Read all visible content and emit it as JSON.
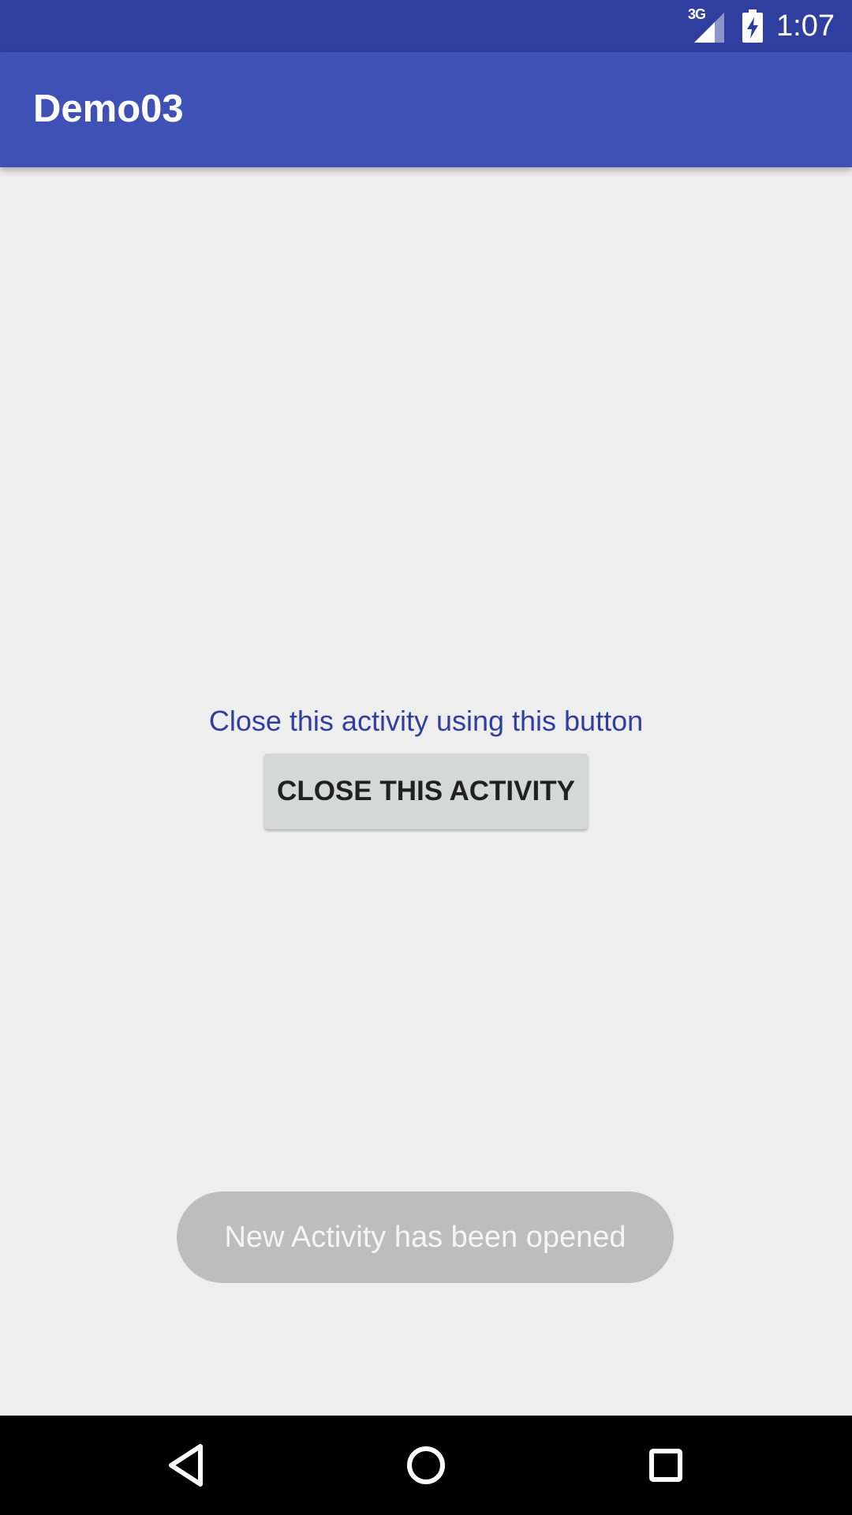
{
  "status_bar": {
    "network_type": "3G",
    "time": "1:07",
    "icons": [
      "signal-icon",
      "battery-charging-icon"
    ]
  },
  "app_bar": {
    "title": "Demo03"
  },
  "main": {
    "instruction_text": "Close this activity using this button",
    "close_button_label": "CLOSE THIS ACTIVITY"
  },
  "toast": {
    "message": "New Activity has been opened"
  },
  "nav_bar": {
    "icons": [
      "back-icon",
      "home-icon",
      "recents-icon"
    ]
  },
  "colors": {
    "status_bar": "#303f9f",
    "app_bar": "#3f51b5",
    "background": "#eeeeee",
    "instruction_text": "#303f9f",
    "button_background": "#d6d7d7",
    "toast_background": "#bdbdbd",
    "nav_bar": "#000000"
  }
}
